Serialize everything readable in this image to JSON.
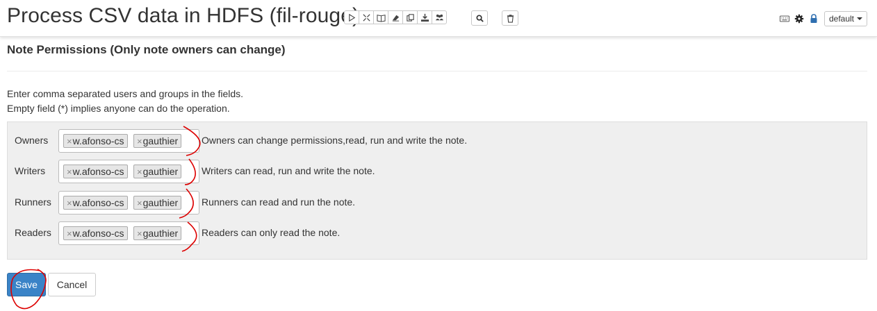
{
  "header": {
    "title": "Process CSV data in HDFS (fil-rouge)",
    "interpreter_binding": "default",
    "toolbar_icons": [
      "run-all-icon",
      "hide-code-icon",
      "hide-output-icon",
      "clear-output-icon",
      "clone-icon",
      "export-icon",
      "version-control-icon"
    ],
    "search_icon": "search-icon",
    "trash_icon": "trash-icon"
  },
  "permissions": {
    "title": "Note Permissions (Only note owners can change)",
    "desc_line1": "Enter comma separated users and groups in the fields.",
    "desc_line2": "Empty field (*) implies anyone can do the operation.",
    "rows": [
      {
        "label": "Owners",
        "tags": [
          "w.afonso-cs",
          "gauthier"
        ],
        "help": "Owners can change permissions,read, run and write the note."
      },
      {
        "label": "Writers",
        "tags": [
          "w.afonso-cs",
          "gauthier"
        ],
        "help": "Writers can read, run and write the note."
      },
      {
        "label": "Runners",
        "tags": [
          "w.afonso-cs",
          "gauthier"
        ],
        "help": "Runners can read and run the note."
      },
      {
        "label": "Readers",
        "tags": [
          "w.afonso-cs",
          "gauthier"
        ],
        "help": "Readers can only read the note."
      }
    ],
    "remove_symbol": "×"
  },
  "actions": {
    "save_label": "Save",
    "cancel_label": "Cancel"
  },
  "colors": {
    "primary": "#3a83c7",
    "annotation": "#dd0000"
  }
}
